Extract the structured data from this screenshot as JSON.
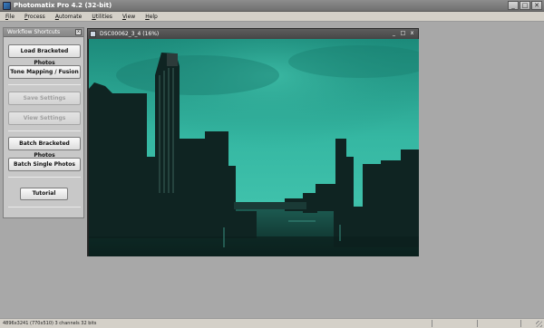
{
  "window": {
    "title": "Photomatix Pro 4.2 (32-bit)",
    "buttons": [
      "_",
      "□",
      "✕"
    ]
  },
  "menu": [
    {
      "label": "File"
    },
    {
      "label": "Process"
    },
    {
      "label": "Automate"
    },
    {
      "label": "Utilities"
    },
    {
      "label": "View"
    },
    {
      "label": "Help"
    }
  ],
  "workflow": {
    "title": "Workflow Shortcuts",
    "close": "x",
    "buttons": [
      {
        "label": "Load Bracketed Photos",
        "enabled": true
      },
      {
        "label": "Tone Mapping / Fusion",
        "enabled": true
      },
      {
        "label": "Save Settings",
        "enabled": false
      },
      {
        "label": "View Settings",
        "enabled": false
      },
      {
        "label": "Batch Bracketed Photos",
        "enabled": true
      },
      {
        "label": "Batch Single Photos",
        "enabled": true
      },
      {
        "label": "Tutorial",
        "enabled": true
      }
    ]
  },
  "image_window": {
    "title": "DSC00062_3_4 (16%)",
    "buttons": [
      "_",
      "□",
      "x"
    ]
  },
  "status": {
    "text": "4896x3241 (770x510) 3 channels 32 bits"
  },
  "colors": {
    "sky_top": "#1e8f7f",
    "sky_mid": "#33b8a3",
    "water": "#123d36",
    "buildings": "#0e1d1c"
  }
}
